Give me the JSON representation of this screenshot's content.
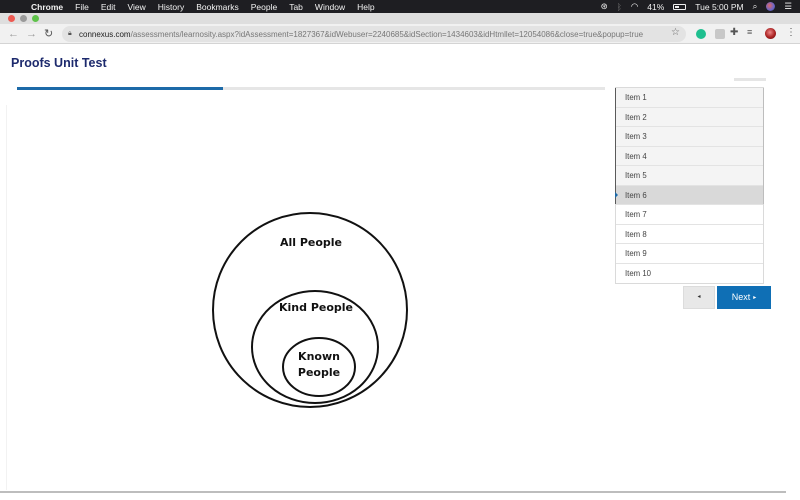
{
  "menubar": {
    "app": "Chrome",
    "items": [
      "File",
      "Edit",
      "View",
      "History",
      "Bookmarks",
      "People",
      "Tab",
      "Window",
      "Help"
    ],
    "battery": "41%",
    "clock": "Tue 5:00 PM"
  },
  "browser": {
    "url_host": "connexus.com",
    "url_rest": "/assessments/learnosity.aspx?idAssessment=1827367&idWebuser=2240685&idSection=1434603&idHtmllet=12054086&close=true&popup=true"
  },
  "page": {
    "title": "Proofs Unit Test",
    "progress_fraction": 0.35
  },
  "diagram": {
    "outer_label": "All People",
    "middle_label": "Kind People",
    "inner_label_line1": "Known",
    "inner_label_line2": "People"
  },
  "items": [
    {
      "label": "Item 1",
      "state": "visited"
    },
    {
      "label": "Item 2",
      "state": "visited"
    },
    {
      "label": "Item 3",
      "state": "visited"
    },
    {
      "label": "Item 4",
      "state": "visited"
    },
    {
      "label": "Item 5",
      "state": "visited"
    },
    {
      "label": "Item 6",
      "state": "current"
    },
    {
      "label": "Item 7",
      "state": "unvisited"
    },
    {
      "label": "Item 8",
      "state": "unvisited"
    },
    {
      "label": "Item 9",
      "state": "unvisited"
    },
    {
      "label": "Item 10",
      "state": "unvisited"
    }
  ],
  "nav": {
    "prev_icon": "◂",
    "next_label": "Next",
    "next_icon": "▸"
  },
  "colors": {
    "accent": "#0f6fb5",
    "title": "#1d2a6d",
    "progress": "#1d6aa8"
  }
}
